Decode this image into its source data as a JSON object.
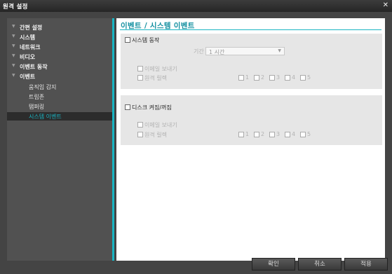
{
  "window": {
    "title": "원격 설정",
    "close_icon": "close-icon"
  },
  "sidebar": {
    "items": [
      {
        "label": "간편 설정"
      },
      {
        "label": "시스템"
      },
      {
        "label": "네트워크"
      },
      {
        "label": "비디오"
      },
      {
        "label": "이벤트 동작"
      },
      {
        "label": "이벤트"
      }
    ],
    "subitems": [
      {
        "label": "움직임 감지"
      },
      {
        "label": "트립존"
      },
      {
        "label": "탬퍼링"
      },
      {
        "label": "시스템 이벤트",
        "selected": true
      }
    ]
  },
  "content": {
    "title": "이벤트 / 시스템 이벤트",
    "system_action": {
      "label": "시스템 동작",
      "period_label": "기간",
      "period_value": "1 시간",
      "email_label": "이메일 보내기",
      "remote_relay_label": "원격 릴렉",
      "relays": [
        "1",
        "2",
        "3",
        "4",
        "5"
      ]
    },
    "disk": {
      "label": "디스크 켜짐/꺼짐",
      "email_label": "이메일 보내기",
      "remote_relay_label": "원격 릴렉",
      "relays": [
        "1",
        "2",
        "3",
        "4",
        "5"
      ]
    }
  },
  "footer": {
    "ok": "확인",
    "cancel": "취소",
    "apply": "적용"
  },
  "colors": {
    "accent": "#19b4c2",
    "title_text": "#138fa0"
  }
}
